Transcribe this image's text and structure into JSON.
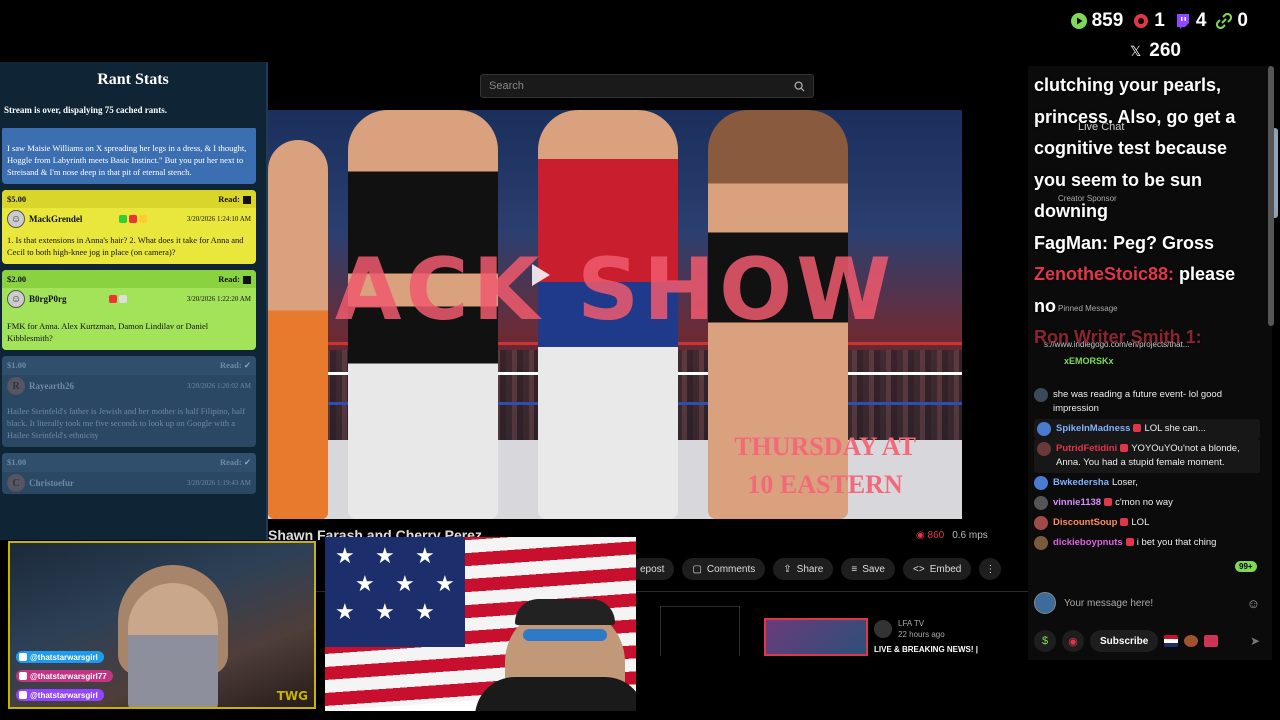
{
  "top_stats": {
    "views": "859",
    "live": "1",
    "twitch": "4",
    "links": "0",
    "x": "260"
  },
  "rant_panel": {
    "title": "Rant Stats",
    "status": "Stream is over, dispalying 75 cached rants.",
    "read_label": "Read:",
    "rants": [
      {
        "style": "blue",
        "amount": "",
        "user": "",
        "date": "",
        "message": "I saw Maisie Williams on X spreading her legs in a dress, & I thought, Hoggle from Labyrinth meets Basic Instinct.\" But you put her next to Streisand & I'm nose deep in that pit of eternal stench."
      },
      {
        "style": "yellow",
        "amount": "$5.00",
        "user": "MackGrendel",
        "date": "3/20/2026 1:24:10 AM",
        "message": "1. Is that extensions in Anna's hair? 2. What does it take for Anna and Cecil to both high-knee jog in place (on camera)?"
      },
      {
        "style": "green",
        "amount": "$2.00",
        "user": "B0rgP0rg",
        "date": "3/20/2026 1:22:20 AM",
        "message": "FMK for Anna. Alex Kurtzman, Damon Lindilav or Daniel Kibblesmith?"
      },
      {
        "style": "faded",
        "amount": "$1.00",
        "user": "Rayearth26",
        "date": "3/20/2026 1:20:02 AM",
        "message": "Hailee Steinfeld's father is Jewish and her mother is half Filipino, half black. It literally took me five seconds to look up on Google with a Hailee Steinfeld's ethnicity"
      },
      {
        "style": "faded",
        "amount": "$1.00",
        "user": "Christoefur",
        "date": "3/20/2026 1:19:43 AM",
        "message": ""
      }
    ]
  },
  "search": {
    "placeholder": "Search"
  },
  "video": {
    "overlay_big": "ACK SHOW",
    "overlay_thursday": "THURSDAY AT",
    "overlay_eastern": "10 EASTERN",
    "title": "Shawn Farash and Cherry Perez",
    "viewers": "860",
    "mps": "0.6 mps"
  },
  "actions": {
    "repost": "epost",
    "comments": "Comments",
    "share": "Share",
    "save": "Save",
    "embed": "Embed"
  },
  "recommended": {
    "channel": "LFA TV",
    "ago": "22 hours ago",
    "title": "LIVE & BREAKING NEWS! |"
  },
  "cam1": {
    "twitter": "@thatstarwarsgirl",
    "threads": "@thatstarwarsgirl77",
    "twitch": "@thatstarwarsgirl",
    "logo": "TWG"
  },
  "chat_overlay": {
    "line1": "clutching your pearls,",
    "line2": "princess. Also, go get a",
    "line3": "cognitive test because",
    "line4": "you seem to be sun",
    "line5": "downing",
    "line6": "FagMan: Peg? Gross",
    "user3": "ZenotheStoic88:",
    "line7": "please",
    "line8": "no",
    "user4": "Ron Writer Smith 1:"
  },
  "chat_ghost": {
    "live_chat": "Live Chat",
    "creator_sponsor": "Creator Sponsor",
    "pinned": "Pinned Message",
    "pinned_link": "s://www.indiegogo.com/en/projects/that...",
    "pinned_user": "xEMORSKx"
  },
  "chat": {
    "messages": [
      {
        "user": "",
        "color": "#bbbbbb",
        "text": "she was reading a future event- lol good impression"
      },
      {
        "user": "SpikeInMadness",
        "color": "#7fb0ff",
        "text": "LOL she can..."
      },
      {
        "user": "PutridFetidini",
        "color": "#e0364a",
        "text": "YOYOuYOu'not a blonde, Anna. You had a stupid female moment."
      },
      {
        "user": "Bwkedersha",
        "color": "#7fb0ff",
        "text": "Loser,"
      },
      {
        "user": "vinnie1138",
        "color": "#d88cff",
        "text": "c'mon no way"
      },
      {
        "user": "DiscountSoup",
        "color": "#ff8c5a",
        "text": "LOL"
      },
      {
        "user": "dickieboypnuts",
        "color": "#e060e0",
        "text": "i bet you that ching"
      }
    ],
    "bubble": "99+",
    "input_placeholder": "Your message here!",
    "subscribe": "Subscribe"
  }
}
